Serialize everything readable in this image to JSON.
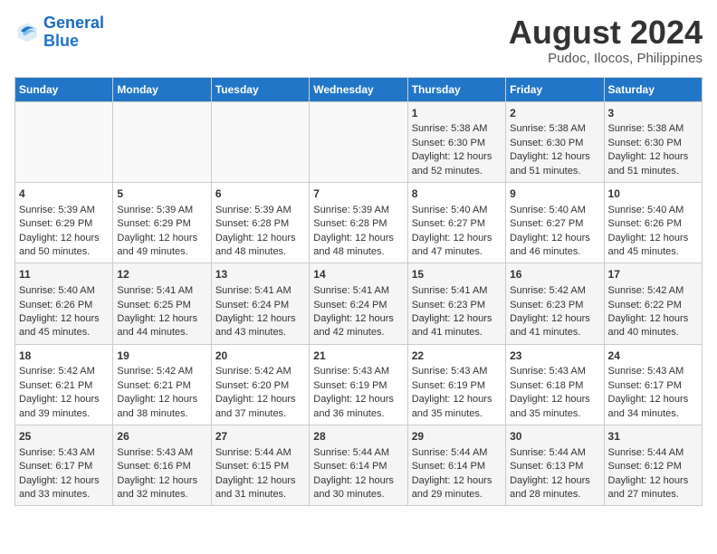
{
  "header": {
    "logo_line1": "General",
    "logo_line2": "Blue",
    "month_year": "August 2024",
    "location": "Pudoc, Ilocos, Philippines"
  },
  "days_of_week": [
    "Sunday",
    "Monday",
    "Tuesday",
    "Wednesday",
    "Thursday",
    "Friday",
    "Saturday"
  ],
  "weeks": [
    [
      {
        "day": "",
        "content": ""
      },
      {
        "day": "",
        "content": ""
      },
      {
        "day": "",
        "content": ""
      },
      {
        "day": "",
        "content": ""
      },
      {
        "day": "1",
        "content": "Sunrise: 5:38 AM\nSunset: 6:30 PM\nDaylight: 12 hours\nand 52 minutes."
      },
      {
        "day": "2",
        "content": "Sunrise: 5:38 AM\nSunset: 6:30 PM\nDaylight: 12 hours\nand 51 minutes."
      },
      {
        "day": "3",
        "content": "Sunrise: 5:38 AM\nSunset: 6:30 PM\nDaylight: 12 hours\nand 51 minutes."
      }
    ],
    [
      {
        "day": "4",
        "content": "Sunrise: 5:39 AM\nSunset: 6:29 PM\nDaylight: 12 hours\nand 50 minutes."
      },
      {
        "day": "5",
        "content": "Sunrise: 5:39 AM\nSunset: 6:29 PM\nDaylight: 12 hours\nand 49 minutes."
      },
      {
        "day": "6",
        "content": "Sunrise: 5:39 AM\nSunset: 6:28 PM\nDaylight: 12 hours\nand 48 minutes."
      },
      {
        "day": "7",
        "content": "Sunrise: 5:39 AM\nSunset: 6:28 PM\nDaylight: 12 hours\nand 48 minutes."
      },
      {
        "day": "8",
        "content": "Sunrise: 5:40 AM\nSunset: 6:27 PM\nDaylight: 12 hours\nand 47 minutes."
      },
      {
        "day": "9",
        "content": "Sunrise: 5:40 AM\nSunset: 6:27 PM\nDaylight: 12 hours\nand 46 minutes."
      },
      {
        "day": "10",
        "content": "Sunrise: 5:40 AM\nSunset: 6:26 PM\nDaylight: 12 hours\nand 45 minutes."
      }
    ],
    [
      {
        "day": "11",
        "content": "Sunrise: 5:40 AM\nSunset: 6:26 PM\nDaylight: 12 hours\nand 45 minutes."
      },
      {
        "day": "12",
        "content": "Sunrise: 5:41 AM\nSunset: 6:25 PM\nDaylight: 12 hours\nand 44 minutes."
      },
      {
        "day": "13",
        "content": "Sunrise: 5:41 AM\nSunset: 6:24 PM\nDaylight: 12 hours\nand 43 minutes."
      },
      {
        "day": "14",
        "content": "Sunrise: 5:41 AM\nSunset: 6:24 PM\nDaylight: 12 hours\nand 42 minutes."
      },
      {
        "day": "15",
        "content": "Sunrise: 5:41 AM\nSunset: 6:23 PM\nDaylight: 12 hours\nand 41 minutes."
      },
      {
        "day": "16",
        "content": "Sunrise: 5:42 AM\nSunset: 6:23 PM\nDaylight: 12 hours\nand 41 minutes."
      },
      {
        "day": "17",
        "content": "Sunrise: 5:42 AM\nSunset: 6:22 PM\nDaylight: 12 hours\nand 40 minutes."
      }
    ],
    [
      {
        "day": "18",
        "content": "Sunrise: 5:42 AM\nSunset: 6:21 PM\nDaylight: 12 hours\nand 39 minutes."
      },
      {
        "day": "19",
        "content": "Sunrise: 5:42 AM\nSunset: 6:21 PM\nDaylight: 12 hours\nand 38 minutes."
      },
      {
        "day": "20",
        "content": "Sunrise: 5:42 AM\nSunset: 6:20 PM\nDaylight: 12 hours\nand 37 minutes."
      },
      {
        "day": "21",
        "content": "Sunrise: 5:43 AM\nSunset: 6:19 PM\nDaylight: 12 hours\nand 36 minutes."
      },
      {
        "day": "22",
        "content": "Sunrise: 5:43 AM\nSunset: 6:19 PM\nDaylight: 12 hours\nand 35 minutes."
      },
      {
        "day": "23",
        "content": "Sunrise: 5:43 AM\nSunset: 6:18 PM\nDaylight: 12 hours\nand 35 minutes."
      },
      {
        "day": "24",
        "content": "Sunrise: 5:43 AM\nSunset: 6:17 PM\nDaylight: 12 hours\nand 34 minutes."
      }
    ],
    [
      {
        "day": "25",
        "content": "Sunrise: 5:43 AM\nSunset: 6:17 PM\nDaylight: 12 hours\nand 33 minutes."
      },
      {
        "day": "26",
        "content": "Sunrise: 5:43 AM\nSunset: 6:16 PM\nDaylight: 12 hours\nand 32 minutes."
      },
      {
        "day": "27",
        "content": "Sunrise: 5:44 AM\nSunset: 6:15 PM\nDaylight: 12 hours\nand 31 minutes."
      },
      {
        "day": "28",
        "content": "Sunrise: 5:44 AM\nSunset: 6:14 PM\nDaylight: 12 hours\nand 30 minutes."
      },
      {
        "day": "29",
        "content": "Sunrise: 5:44 AM\nSunset: 6:14 PM\nDaylight: 12 hours\nand 29 minutes."
      },
      {
        "day": "30",
        "content": "Sunrise: 5:44 AM\nSunset: 6:13 PM\nDaylight: 12 hours\nand 28 minutes."
      },
      {
        "day": "31",
        "content": "Sunrise: 5:44 AM\nSunset: 6:12 PM\nDaylight: 12 hours\nand 27 minutes."
      }
    ]
  ]
}
